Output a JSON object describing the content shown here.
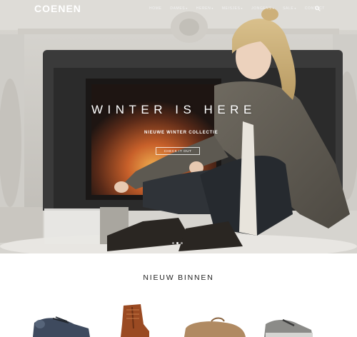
{
  "header": {
    "logo": "COENEN",
    "menu": [
      {
        "label": "HOME",
        "has_caret": false
      },
      {
        "label": "DAMES",
        "has_caret": true
      },
      {
        "label": "HEREN",
        "has_caret": true
      },
      {
        "label": "MEISJES",
        "has_caret": true
      },
      {
        "label": "JONGENS",
        "has_caret": true
      },
      {
        "label": "SALE",
        "has_caret": true
      },
      {
        "label": "CONTACT",
        "has_caret": false
      }
    ],
    "caret_glyph": "▾",
    "search_icon": "search-icon"
  },
  "hero": {
    "headline": "WINTER IS HERE",
    "subline": "NIEUWE WINTER COLLECTIE",
    "cta_label": "CHECK IT OUT",
    "slide_count": 3,
    "active_slide": 1
  },
  "new_arrivals": {
    "title": "NIEUW BINNEN",
    "products": [
      {
        "name": "blue-sneaker",
        "color": "#3e4a5e"
      },
      {
        "name": "cognac-boot",
        "color": "#9a4a22"
      },
      {
        "name": "tan-moccasin",
        "color": "#b08a62"
      },
      {
        "name": "grey-sneaker",
        "color": "#8b8b88"
      }
    ]
  },
  "colors": {
    "nav_text": "#f2f2f2",
    "hero_text": "#ffffff",
    "section_text": "#222222"
  }
}
